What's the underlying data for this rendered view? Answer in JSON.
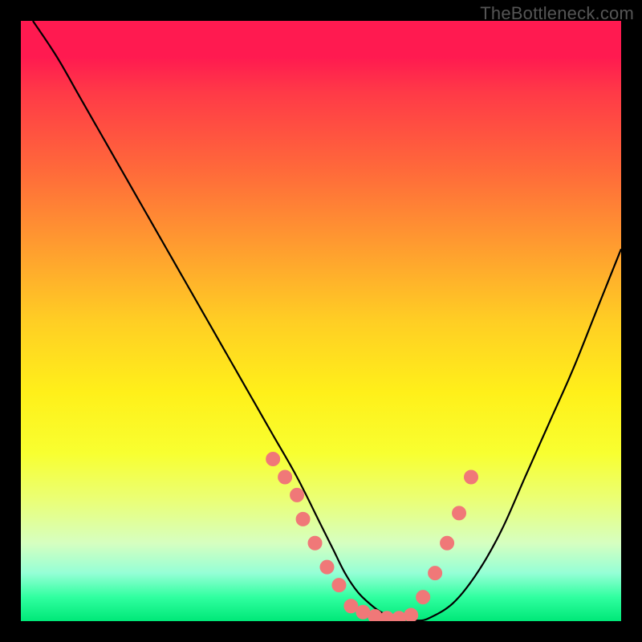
{
  "watermark": "TheBottleneck.com",
  "colors": {
    "curve": "#000000",
    "dot_fill": "#f07878",
    "dot_stroke": "#f07878",
    "gradient_top": "#ff1a50",
    "gradient_bottom": "#00e878",
    "frame": "#000000"
  },
  "chart_data": {
    "type": "line",
    "title": "",
    "xlabel": "",
    "ylabel": "",
    "xlim": [
      0,
      100
    ],
    "ylim": [
      0,
      100
    ],
    "grid": false,
    "legend": false,
    "series": [
      {
        "name": "bottleneck-curve",
        "x": [
          2,
          6,
          10,
          14,
          18,
          22,
          26,
          30,
          34,
          38,
          42,
          46,
          50,
          52,
          54,
          56,
          58,
          60,
          62,
          64,
          66,
          68,
          72,
          76,
          80,
          84,
          88,
          92,
          96,
          100
        ],
        "y": [
          100,
          94,
          87,
          80,
          73,
          66,
          59,
          52,
          45,
          38,
          31,
          24,
          16,
          12,
          8,
          5,
          3,
          1.5,
          0.8,
          0.3,
          0.1,
          0.5,
          3,
          8,
          15,
          24,
          33,
          42,
          52,
          62
        ]
      }
    ],
    "markers": [
      {
        "name": "dots-left",
        "x": [
          42,
          44,
          46,
          47,
          49,
          51,
          53
        ],
        "y": [
          27,
          24,
          21,
          17,
          13,
          9,
          6
        ]
      },
      {
        "name": "dots-floor",
        "x": [
          55,
          57,
          59,
          61,
          63,
          65
        ],
        "y": [
          2.5,
          1.5,
          0.8,
          0.5,
          0.5,
          1
        ]
      },
      {
        "name": "dots-right",
        "x": [
          67,
          69,
          71,
          73,
          75
        ],
        "y": [
          4,
          8,
          13,
          18,
          24
        ]
      }
    ]
  }
}
